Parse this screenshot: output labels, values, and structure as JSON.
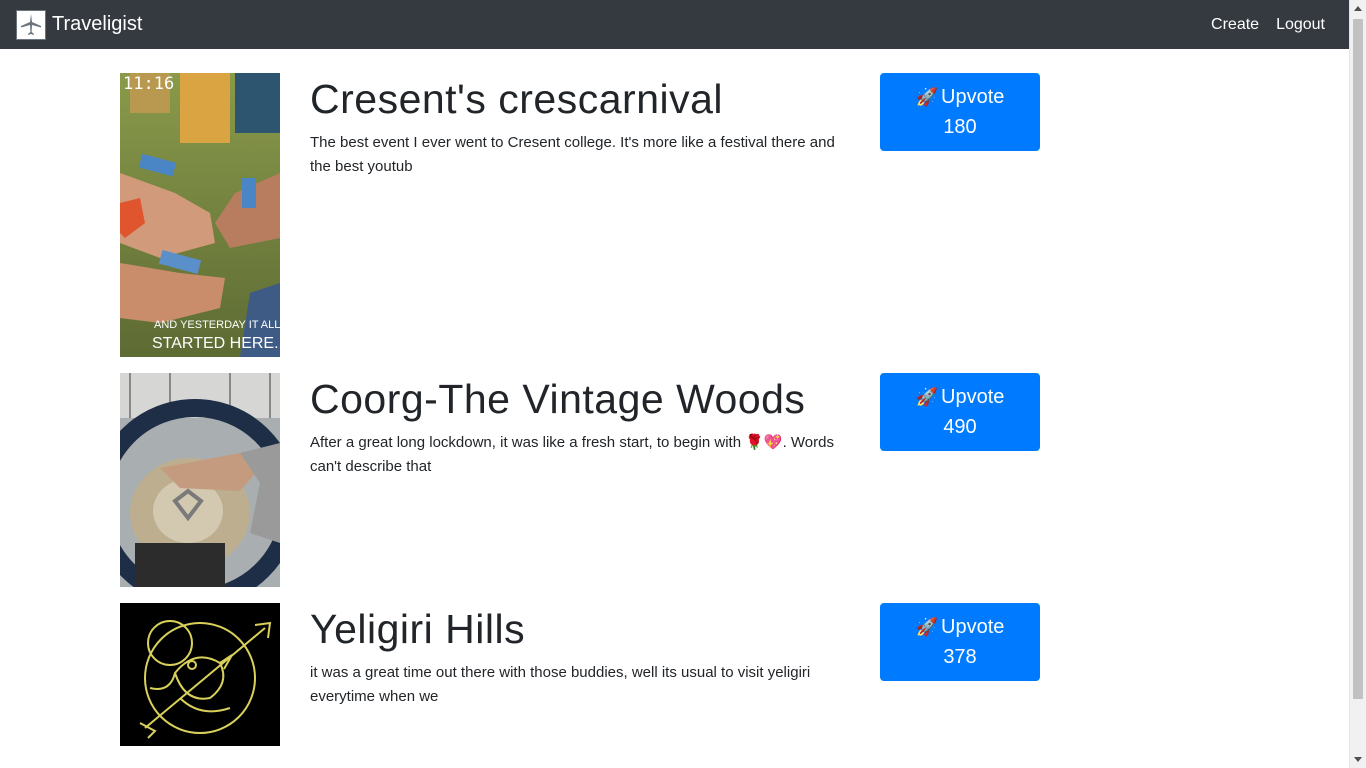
{
  "navbar": {
    "brand": "Traveligist",
    "brand_icon": "airplane-icon",
    "links": [
      "Create",
      "Logout"
    ]
  },
  "posts": [
    {
      "title": "Cresent's crescarnival",
      "description": "The best event I ever went to Cresent college. It's more like a festival there and the best youtub",
      "vote_label": "Upvote",
      "votes": "180",
      "photo_caption_time": "11:16",
      "photo_caption_line1": "AND YESTERDAY IT ALL",
      "photo_caption_line2": "STARTED HERE..."
    },
    {
      "title": "Coorg-The Vintage Woods",
      "description": "After a great long lockdown, it was like a fresh start, to begin with 🌹💖. Words can't describe that",
      "vote_label": "Upvote",
      "votes": "490"
    },
    {
      "title": "Yeligiri Hills",
      "description": "it was a great time out there with those buddies, well its usual to visit yeligiri everytime when we",
      "vote_label": "Upvote",
      "votes": "378"
    }
  ],
  "colors": {
    "navbar_bg": "#343a40",
    "button_primary": "#007bff"
  }
}
